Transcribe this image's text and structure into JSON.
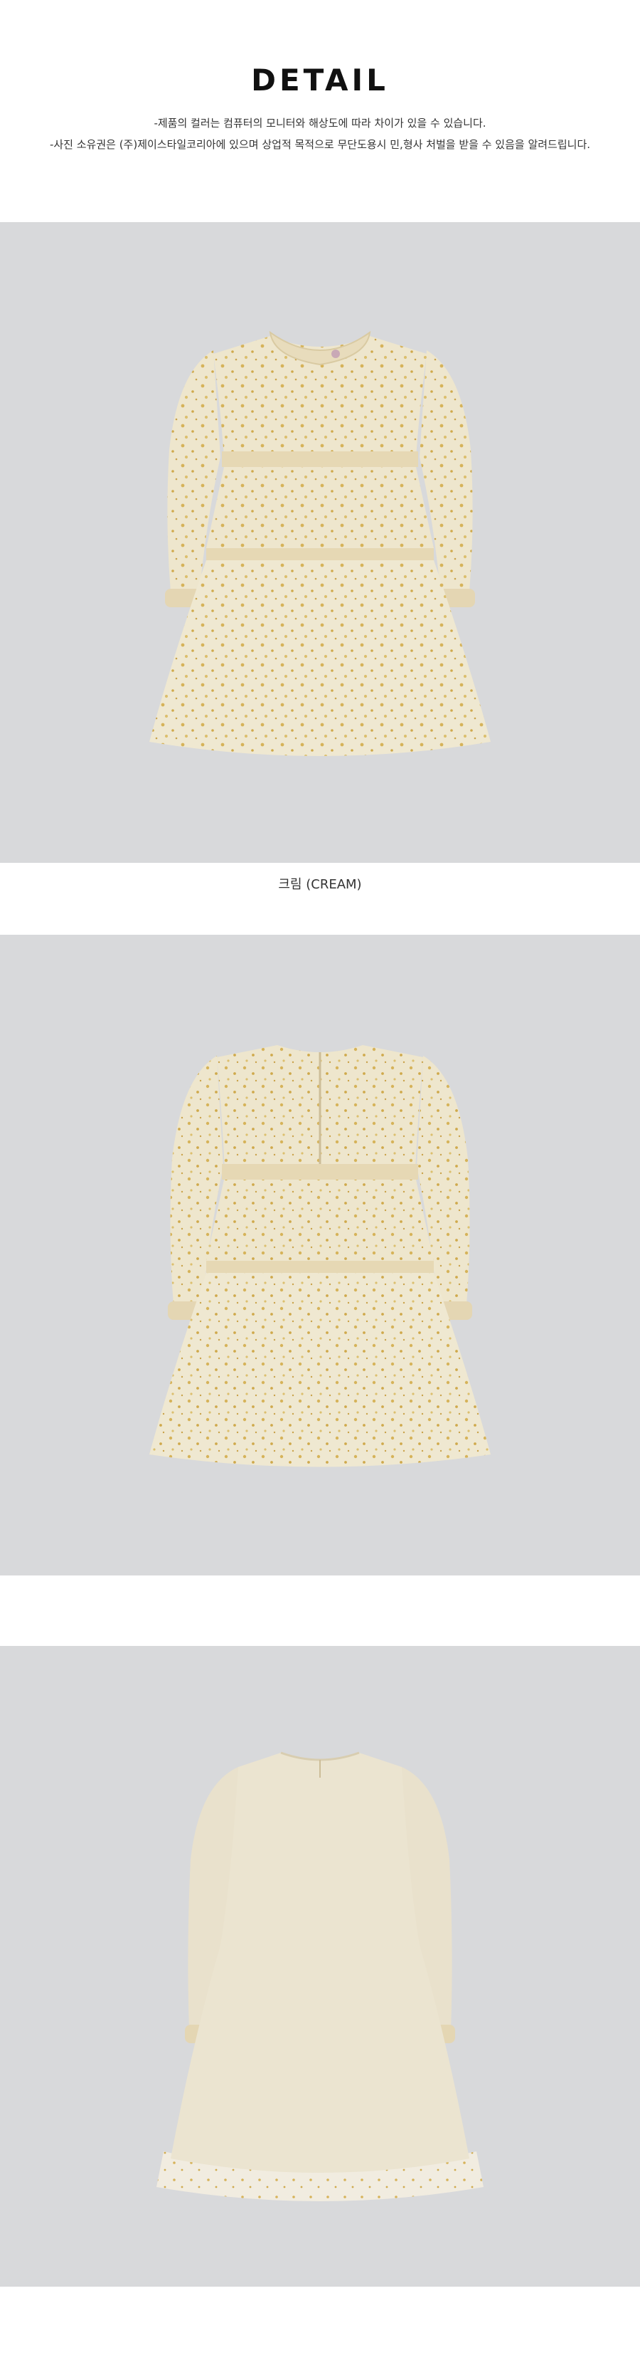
{
  "header": {
    "title": "DETAIL",
    "notes": [
      "-제품의 컬러는 컴퓨터의 모니터와 해상도에 따라 차이가 있을 수 있습니다.",
      "-사진 소유권은 (주)제이스타일코리아에 있으며 상업적 목적으로 무단도용시 민,형사 처벌을 받을 수 있음을 알려드립니다."
    ]
  },
  "products": [
    {
      "view": "front",
      "caption": "크림 (CREAM)"
    },
    {
      "view": "back"
    },
    {
      "view": "lining"
    }
  ],
  "colors": {
    "panel_bg": "#d8d9db",
    "dress_cream": "#ede4c8",
    "dress_shadow": "#ddd1ad",
    "dot_gold": "#d6b35a",
    "lining_cream": "#e9e1cc"
  }
}
